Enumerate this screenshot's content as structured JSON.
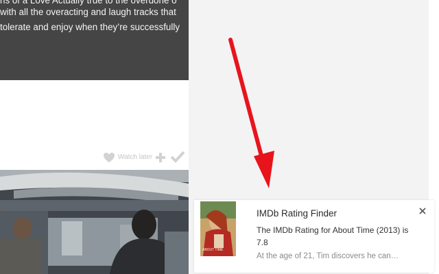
{
  "article": {
    "line0": "ns of a Love Actually true to the overdone o",
    "line1": "with all the overacting and laugh tracks that",
    "line2": "tolerate and enjoy when they’re successfully"
  },
  "card_actions": {
    "watch_later_label": "Watch later",
    "icons": [
      "heart-icon",
      "plus-icon",
      "check-icon"
    ]
  },
  "notification": {
    "title": "IMDb Rating Finder",
    "message": "The IMDb Rating for About Time (2013) is 7.8",
    "plot_excerpt": "At the age of 21, Tim discovers he can…",
    "poster_text": "ABOUT TIME",
    "close_icon": "close-icon"
  },
  "colors": {
    "arrow": "#e8141c",
    "dark_card": "#454545",
    "background": "#f2f2f3"
  }
}
